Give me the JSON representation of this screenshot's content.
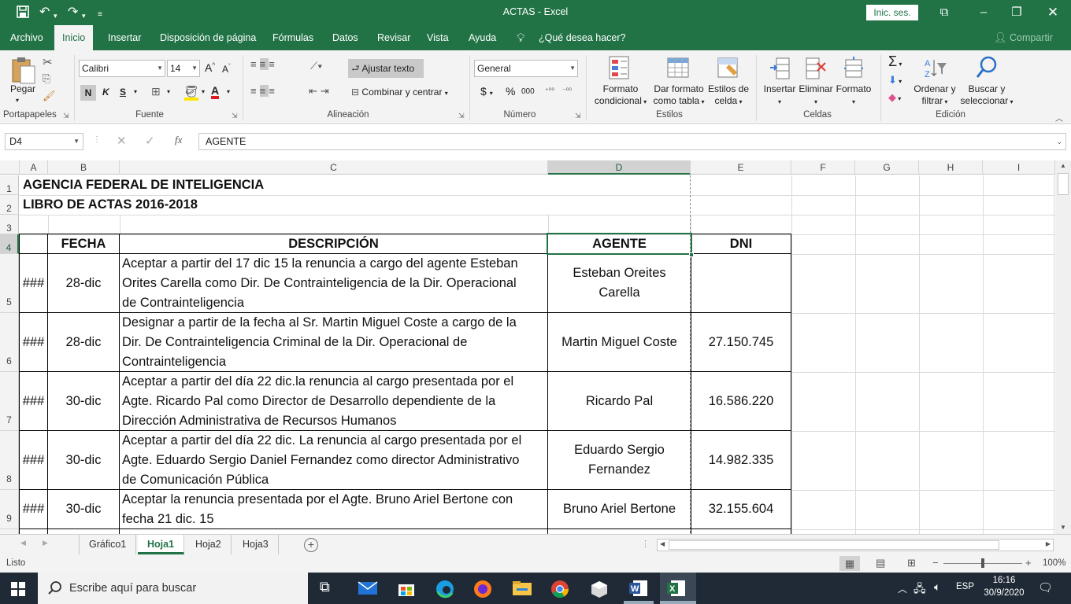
{
  "window": {
    "title": "ACTAS  -  Excel",
    "signin_label": "Inic. ses.",
    "share_label": "Compartir"
  },
  "tabs": [
    "Archivo",
    "Inicio",
    "Insertar",
    "Disposición de página",
    "Fórmulas",
    "Datos",
    "Revisar",
    "Vista",
    "Ayuda"
  ],
  "tell_me": "¿Qué desea hacer?",
  "ribbon": {
    "clipboard": {
      "paste": "Pegar",
      "group": "Portapapeles"
    },
    "font": {
      "name": "Calibri",
      "size": "14",
      "bold": "N",
      "italic": "K",
      "underline": "S",
      "group": "Fuente"
    },
    "alignment": {
      "wrap": "Ajustar texto",
      "merge": "Combinar y centrar",
      "group": "Alineación"
    },
    "number": {
      "format": "General",
      "currency": "$",
      "percent": "%",
      "thousands": "000",
      "group": "Número"
    },
    "styles": {
      "conditional_1": "Formato",
      "conditional_2": "condicional",
      "table_1": "Dar formato",
      "table_2": "como tabla",
      "cell_1": "Estilos de",
      "cell_2": "celda",
      "group": "Estilos"
    },
    "cells": {
      "insert": "Insertar",
      "delete": "Eliminar",
      "format": "Formato",
      "group": "Celdas"
    },
    "editing": {
      "sort_1": "Ordenar y",
      "sort_2": "filtrar",
      "find_1": "Buscar y",
      "find_2": "seleccionar",
      "group": "Edición"
    }
  },
  "formula_bar": {
    "name_box": "D4",
    "fx": "fx",
    "content": "AGENTE"
  },
  "columns": [
    "A",
    "B",
    "C",
    "D",
    "E",
    "F",
    "G",
    "H",
    "I"
  ],
  "rows": [
    "1",
    "2",
    "3",
    "4",
    "5",
    "6",
    "7",
    "8",
    "9"
  ],
  "sheet": {
    "title1": "AGENCIA FEDERAL DE INTELIGENCIA",
    "title2": "LIBRO DE ACTAS 2016-2018",
    "headers": {
      "fecha": "FECHA",
      "descripcion": "DESCRIPCIÓN",
      "agente": "AGENTE",
      "dni": "DNI"
    },
    "records": [
      {
        "a": "###",
        "fecha": "28-dic",
        "desc_lines": [
          "Aceptar a partir del 17 dic 15 la renuncia a cargo del agente Esteban",
          "Orites Carella como Dir. De Contrainteligencia de la Dir. Operacional",
          "de Contrainteligencia"
        ],
        "agente_lines": [
          "Esteban Oreites",
          "Carella"
        ],
        "dni": ""
      },
      {
        "a": "###",
        "fecha": "28-dic",
        "desc_lines": [
          "Designar a partir de la fecha al Sr. Martin Miguel Coste  a cargo de la",
          "Dir. De Contrainteligencia Criminal de la Dir. Operacional de",
          "Contrainteligencia"
        ],
        "agente_lines": [
          "Martin Miguel Coste"
        ],
        "dni": "27.150.745"
      },
      {
        "a": "###",
        "fecha": "30-dic",
        "desc_lines": [
          "Aceptar a partir del día 22 dic.la renuncia al cargo presentada por el",
          "Agte. Ricardo Pal  como Director de Desarrollo dependiente de la",
          "Dirección Administrativa de Recursos Humanos"
        ],
        "agente_lines": [
          "Ricardo Pal"
        ],
        "dni": "16.586.220"
      },
      {
        "a": "###",
        "fecha": "30-dic",
        "desc_lines": [
          "Aceptar a partir del día 22 dic. La renuncia al cargo presentada por el",
          "Agte. Eduardo Sergio Daniel Fernandez como director  Administrativo",
          "de Comunicación Pública"
        ],
        "agente_lines": [
          "Eduardo Sergio",
          "Fernandez"
        ],
        "dni": "14.982.335"
      },
      {
        "a": "###",
        "fecha": "30-dic",
        "desc_lines": [
          "Aceptar la renuncia presentada por el Agte. Bruno Ariel Bertone con",
          "fecha 21 dic. 15"
        ],
        "agente_lines": [
          "Bruno Ariel Bertone"
        ],
        "dni": "32.155.604"
      }
    ]
  },
  "sheet_tabs": [
    "Gráfico1",
    "Hoja1",
    "Hoja2",
    "Hoja3"
  ],
  "status": {
    "ready": "Listo",
    "zoom": "100%"
  },
  "taskbar": {
    "search": "Escribe aquí para buscar",
    "lang": "ESP",
    "time": "16:16",
    "date": "30/9/2020"
  },
  "colors": {
    "excel_green": "#217346",
    "taskbar": "#1f2a36"
  }
}
